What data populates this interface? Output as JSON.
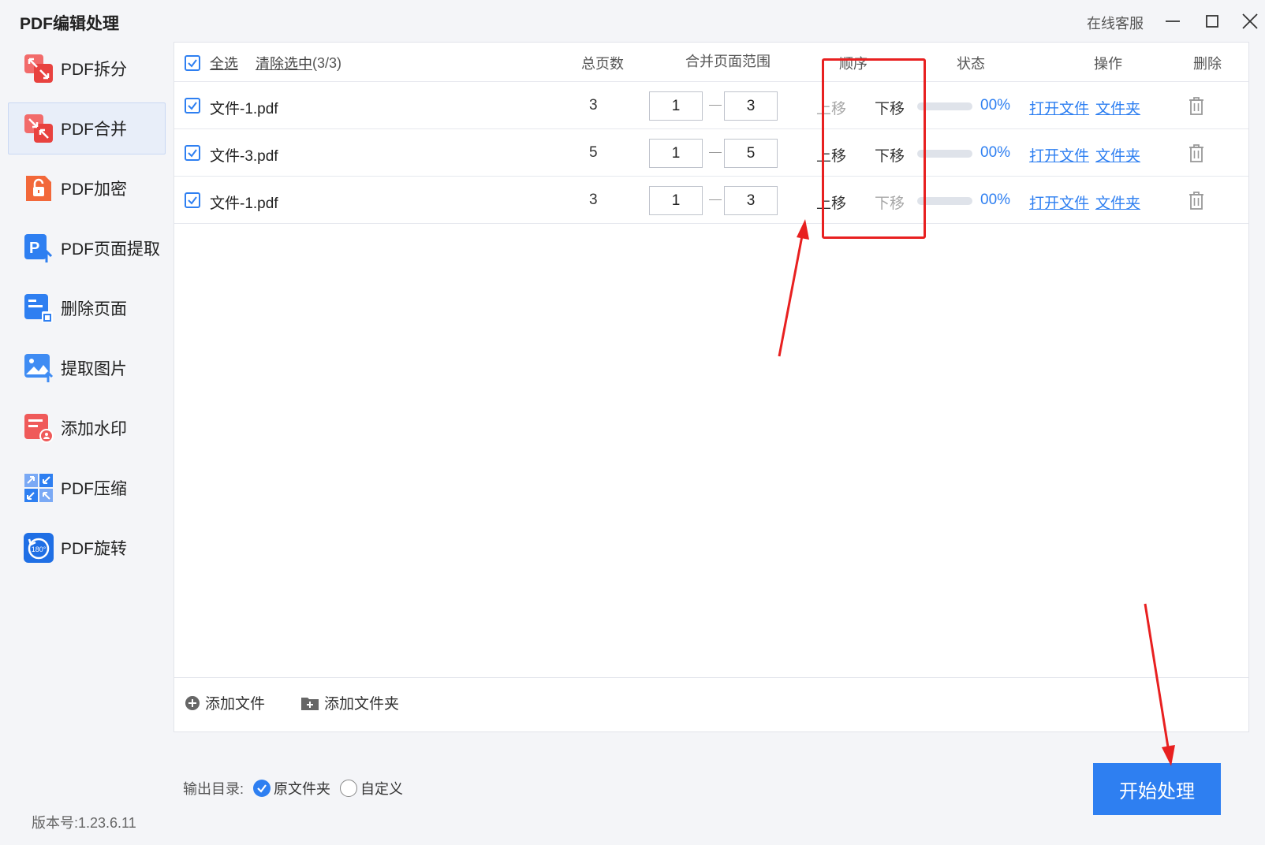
{
  "app": {
    "title": "PDF编辑处理",
    "support_label": "在线客服"
  },
  "sidebar": {
    "items": [
      {
        "label": "PDF拆分",
        "icon": "split-icon",
        "active": false
      },
      {
        "label": "PDF合并",
        "icon": "merge-icon",
        "active": true
      },
      {
        "label": "PDF加密",
        "icon": "lock-icon",
        "active": false
      },
      {
        "label": "PDF页面提取",
        "icon": "page-extract-icon",
        "active": false
      },
      {
        "label": "删除页面",
        "icon": "delete-page-icon",
        "active": false
      },
      {
        "label": "提取图片",
        "icon": "image-extract-icon",
        "active": false
      },
      {
        "label": "添加水印",
        "icon": "watermark-icon",
        "active": false
      },
      {
        "label": "PDF压缩",
        "icon": "compress-icon",
        "active": false
      },
      {
        "label": "PDF旋转",
        "icon": "rotate-icon",
        "active": false
      }
    ]
  },
  "table": {
    "select_all": "全选",
    "clear_selection": "清除选中",
    "selection_count": "(3/3)",
    "headers": {
      "total_pages": "总页数",
      "merge_range": "合并页面范围",
      "order": "顺序",
      "status": "状态",
      "actions": "操作",
      "delete": "删除"
    },
    "rows": [
      {
        "checked": true,
        "filename": "文件-1.pdf",
        "total_pages": "3",
        "range_from": "1",
        "range_to": "3",
        "move_up": "上移",
        "move_down": "下移",
        "up_enabled": false,
        "down_enabled": true,
        "progress": 0,
        "status": "00%",
        "open_file": "打开文件",
        "folder": "文件夹"
      },
      {
        "checked": true,
        "filename": "文件-3.pdf",
        "total_pages": "5",
        "range_from": "1",
        "range_to": "5",
        "move_up": "上移",
        "move_down": "下移",
        "up_enabled": true,
        "down_enabled": true,
        "progress": 0,
        "status": "00%",
        "open_file": "打开文件",
        "folder": "文件夹"
      },
      {
        "checked": true,
        "filename": "文件-1.pdf",
        "total_pages": "3",
        "range_from": "1",
        "range_to": "3",
        "move_up": "上移",
        "move_down": "下移",
        "up_enabled": true,
        "down_enabled": false,
        "progress": 0,
        "status": "00%",
        "open_file": "打开文件",
        "folder": "文件夹"
      }
    ]
  },
  "footer": {
    "add_file": "添加文件",
    "add_folder": "添加文件夹"
  },
  "output": {
    "label": "输出目录:",
    "option_original": "原文件夹",
    "option_custom": "自定义",
    "selected": "original"
  },
  "version": "版本号:1.23.6.11",
  "start_button": "开始处理",
  "colors": {
    "accent": "#2e7ff1",
    "annotation": "#e82020"
  }
}
